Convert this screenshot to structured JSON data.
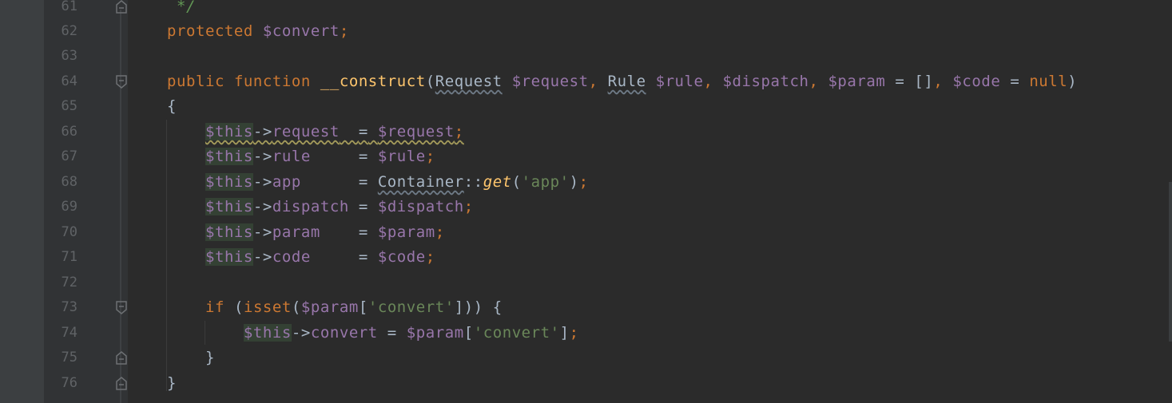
{
  "editor": {
    "language": "php",
    "colors": {
      "background": "#2b2b2b",
      "gutter": "#313335",
      "keyword": "#cc7832",
      "variable": "#9876aa",
      "plain": "#a9b7c6",
      "function": "#ffc66d",
      "string": "#6a8759",
      "comment": "#629755",
      "line_number": "#606366"
    },
    "lines": [
      {
        "number": "61",
        "fold": "end"
      },
      {
        "number": "62"
      },
      {
        "number": "63"
      },
      {
        "number": "64",
        "fold": "start"
      },
      {
        "number": "65"
      },
      {
        "number": "66"
      },
      {
        "number": "67"
      },
      {
        "number": "68"
      },
      {
        "number": "69"
      },
      {
        "number": "70"
      },
      {
        "number": "71"
      },
      {
        "number": "72"
      },
      {
        "number": "73",
        "fold": "start"
      },
      {
        "number": "74"
      },
      {
        "number": "75",
        "fold": "end"
      },
      {
        "number": "76",
        "fold": "end"
      }
    ],
    "code": {
      "l61": {
        "comment_end": " */"
      },
      "l62": {
        "kw": "protected",
        "var": "$convert",
        "semi": ";"
      },
      "l64": {
        "kw1": "public",
        "kw2": "function",
        "fname": "__construct",
        "open": "(",
        "type1": "Request",
        "arg1": "$request",
        "comma1": ",",
        "type2": "Rule",
        "arg2": "$rule",
        "comma2": ",",
        "arg3": "$dispatch",
        "comma3": ",",
        "arg4": "$param",
        "eq4": "=",
        "default4": "[]",
        "comma4": ",",
        "arg5": "$code",
        "eq5": "=",
        "default5": "null",
        "close": ")"
      },
      "l65": {
        "brace": "{"
      },
      "l66": {
        "this": "$this",
        "arrow": "->",
        "prop": "request",
        "pad": "  ",
        "eq": "=",
        "val": "$request",
        "semi": ";"
      },
      "l67": {
        "this": "$this",
        "arrow": "->",
        "prop": "rule",
        "pad": "     ",
        "eq": "=",
        "val": "$rule",
        "semi": ";"
      },
      "l68": {
        "this": "$this",
        "arrow": "->",
        "prop": "app",
        "pad": "      ",
        "eq": "=",
        "cls": "Container",
        "scope": "::",
        "method": "get",
        "open": "(",
        "str": "'app'",
        "close": ")",
        "semi": ";"
      },
      "l69": {
        "this": "$this",
        "arrow": "->",
        "prop": "dispatch",
        "pad": " ",
        "eq": "=",
        "val": "$dispatch",
        "semi": ";"
      },
      "l70": {
        "this": "$this",
        "arrow": "->",
        "prop": "param",
        "pad": "    ",
        "eq": "=",
        "val": "$param",
        "semi": ";"
      },
      "l71": {
        "this": "$this",
        "arrow": "->",
        "prop": "code",
        "pad": "     ",
        "eq": "=",
        "val": "$code",
        "semi": ";"
      },
      "l73": {
        "kw": "if",
        "open": "(",
        "fn": "isset",
        "open2": "(",
        "var": "$param",
        "lb": "[",
        "str": "'convert'",
        "rb": "]",
        "close": "))",
        "brace": "{"
      },
      "l74": {
        "this": "$this",
        "arrow": "->",
        "prop": "convert",
        "eq": "=",
        "var": "$param",
        "lb": "[",
        "str": "'convert'",
        "rb": "]",
        "semi": ";"
      },
      "l75": {
        "brace": "}"
      },
      "l76": {
        "brace": "}"
      }
    }
  }
}
